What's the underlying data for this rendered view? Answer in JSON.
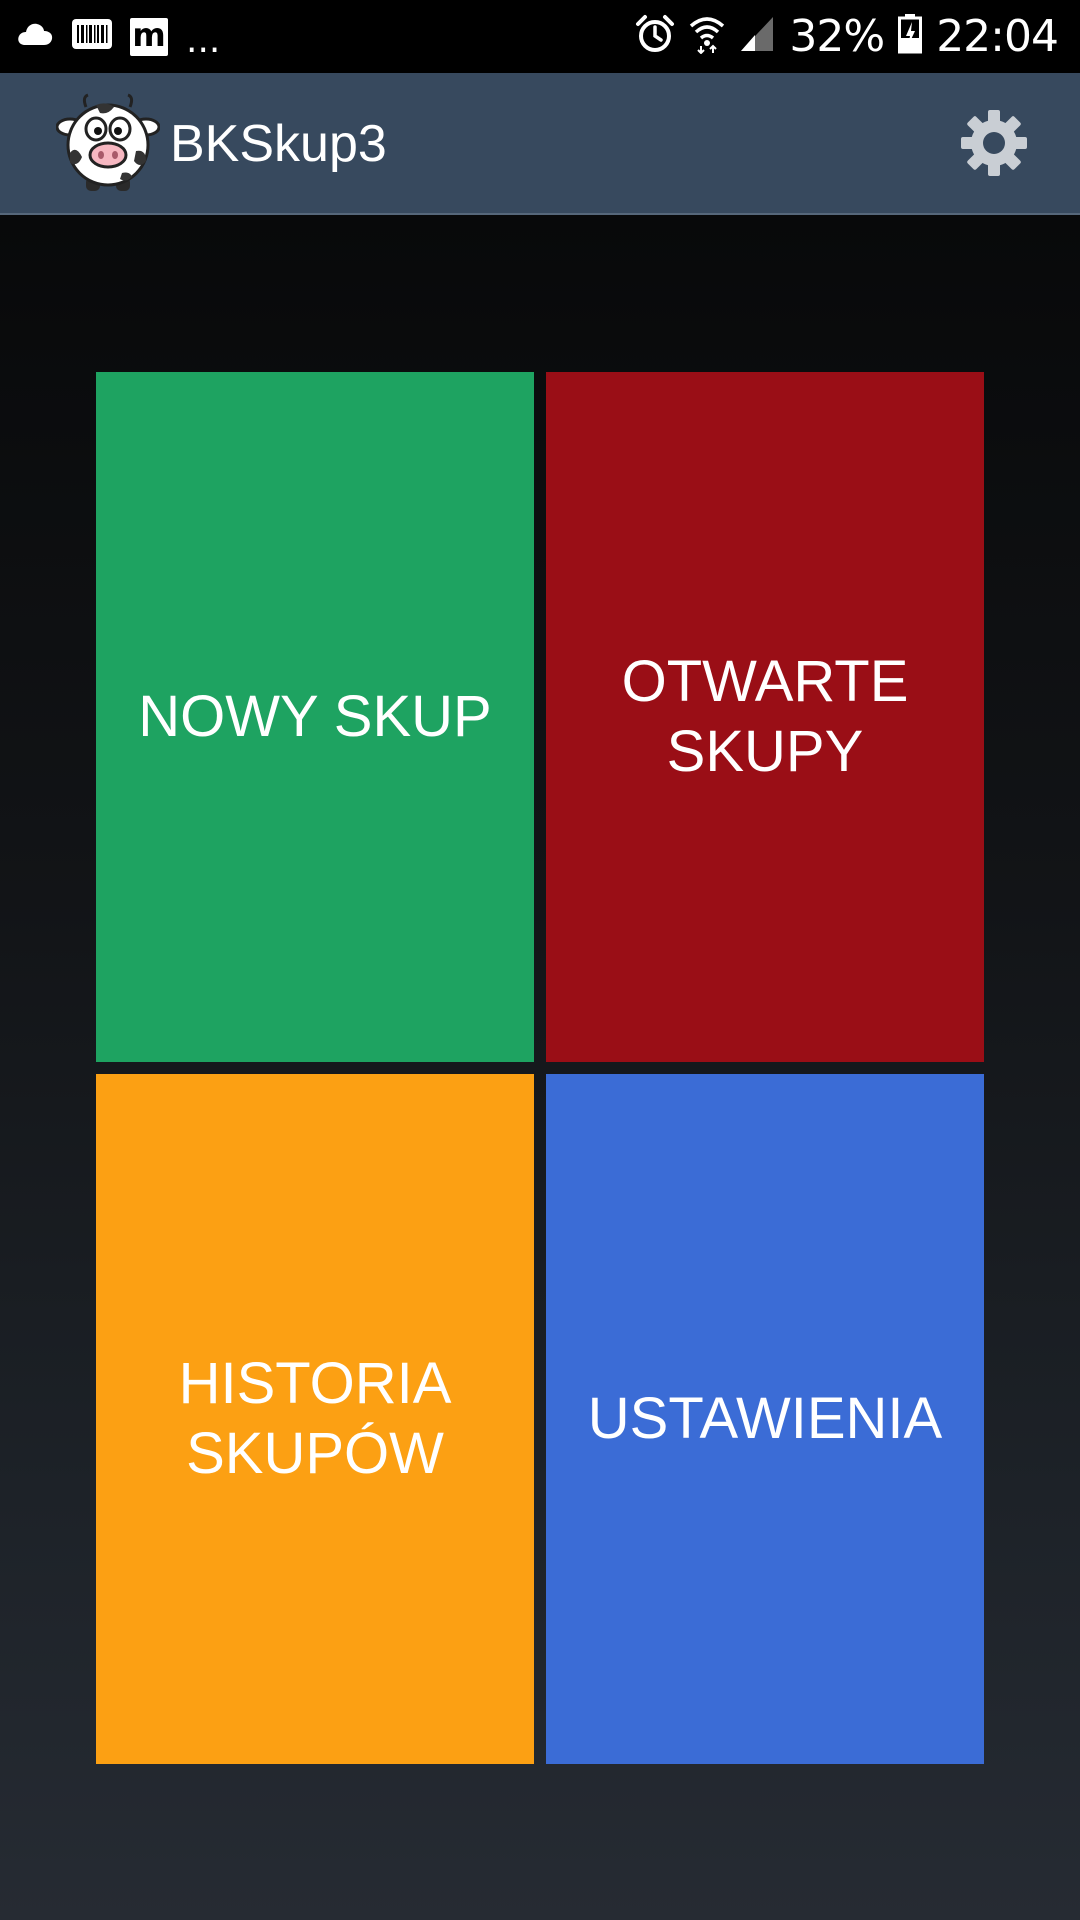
{
  "status_bar": {
    "battery": "32%",
    "time": "22:04",
    "more_indicator": "...",
    "notification_m_label": "m",
    "icons": [
      "cloud-icon",
      "barcode-icon",
      "m-app-icon",
      "alarm-icon",
      "wifi-icon",
      "cell-signal-icon",
      "battery-charging-icon"
    ]
  },
  "app_bar": {
    "title": "BKSkup3",
    "logo_icon": "cow-icon",
    "settings_icon": "gear-icon"
  },
  "tiles": [
    {
      "label_lines": [
        "NOWY SKUP"
      ],
      "color": "#1ea361"
    },
    {
      "label_lines": [
        "OTWARTE",
        "SKUPY"
      ],
      "color": "#9a0e16"
    },
    {
      "label_lines": [
        "HISTORIA",
        "SKUPÓW"
      ],
      "color": "#fca013"
    },
    {
      "label_lines": [
        "USTAWIENIA"
      ],
      "color": "#3b6cd6"
    }
  ],
  "colors": {
    "app_bar": "#37495e",
    "status_bar": "#000000"
  }
}
